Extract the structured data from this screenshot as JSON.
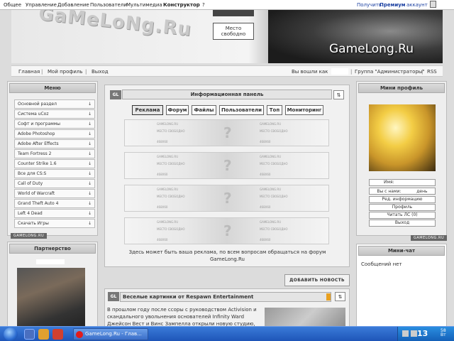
{
  "admin_bar": {
    "left_items": [
      "Общее",
      "Управление",
      "Добавление",
      "Пользователи",
      "Мультимедиа",
      "Конструктор",
      "?"
    ],
    "right_text": "Получить",
    "right_bold": "Премиум",
    "right_end": "аккаунт"
  },
  "header": {
    "logo_text": "GaMeLoNg.Ru",
    "ad_box": "Место свободно",
    "brand": "GameLong.Ru"
  },
  "nav": {
    "links": [
      "Главная",
      "Мой профиль",
      "Выход"
    ],
    "logged_in": "Вы вошли как",
    "group": "Группа \"Администраторы\"",
    "rss": "RSS"
  },
  "menu": {
    "title": "Меню",
    "items": [
      "Основной раздел",
      "Система uCoz",
      "Софт и программы",
      "Adobe Photoshop",
      "Adobe After Effects",
      "Team Fortress 2",
      "Counter Strike 1.6",
      "Все для CS:S",
      "Call of Duty",
      "World of Warcraft",
      "Grand Theft Auto 4",
      "Left 4 Dead",
      "Скачать Игры"
    ],
    "footer_tag": "GAMELONG.RU"
  },
  "partners": {
    "title": "Партнерство"
  },
  "info_panel": {
    "gl": "GL",
    "title": "Информационная панель",
    "toggle": "⇅",
    "tabs": [
      "Реклама",
      "Форум",
      "Файлы",
      "Пользователи",
      "Топ",
      "Мониторинг"
    ],
    "ad_banner": {
      "site": "GAMELONG.RU",
      "free": "МЕСТО СВОБОДНО",
      "size": "468X60"
    },
    "note": "Здесь может быть ваша реклама, по всем вопросам обращаться на форум GameLong.Ru"
  },
  "add_news": "ДОБАВИТЬ НОВОСТЬ",
  "news": {
    "gl": "GL",
    "title": "Веселые картинки от Respawn Entertainment",
    "body": "В прошлом году после ссоры с руководством Activision и скандального увольнения основателей Infinity Ward Джейсон Вест и Винс Зампелла открыли новую студию, Respawn Entertainment, и перенеслись под"
  },
  "profile": {
    "title": "Мини профиль",
    "name_label": "Имя:",
    "since_label": "Вы с нами:",
    "since_suffix": "день",
    "buttons": [
      "Ред. информацию",
      "Профиль",
      "Читать ЛС (0)",
      "Выход"
    ],
    "footer_tag": "GAMELONG.RU"
  },
  "chat": {
    "title": "Мини-чат",
    "message": "Сообщений нет"
  },
  "taskbar": {
    "task_label": "GameLong.Ru - Глав...",
    "clock": "13",
    "clock_small_top": "58",
    "clock_small_bottom": "Вт"
  }
}
